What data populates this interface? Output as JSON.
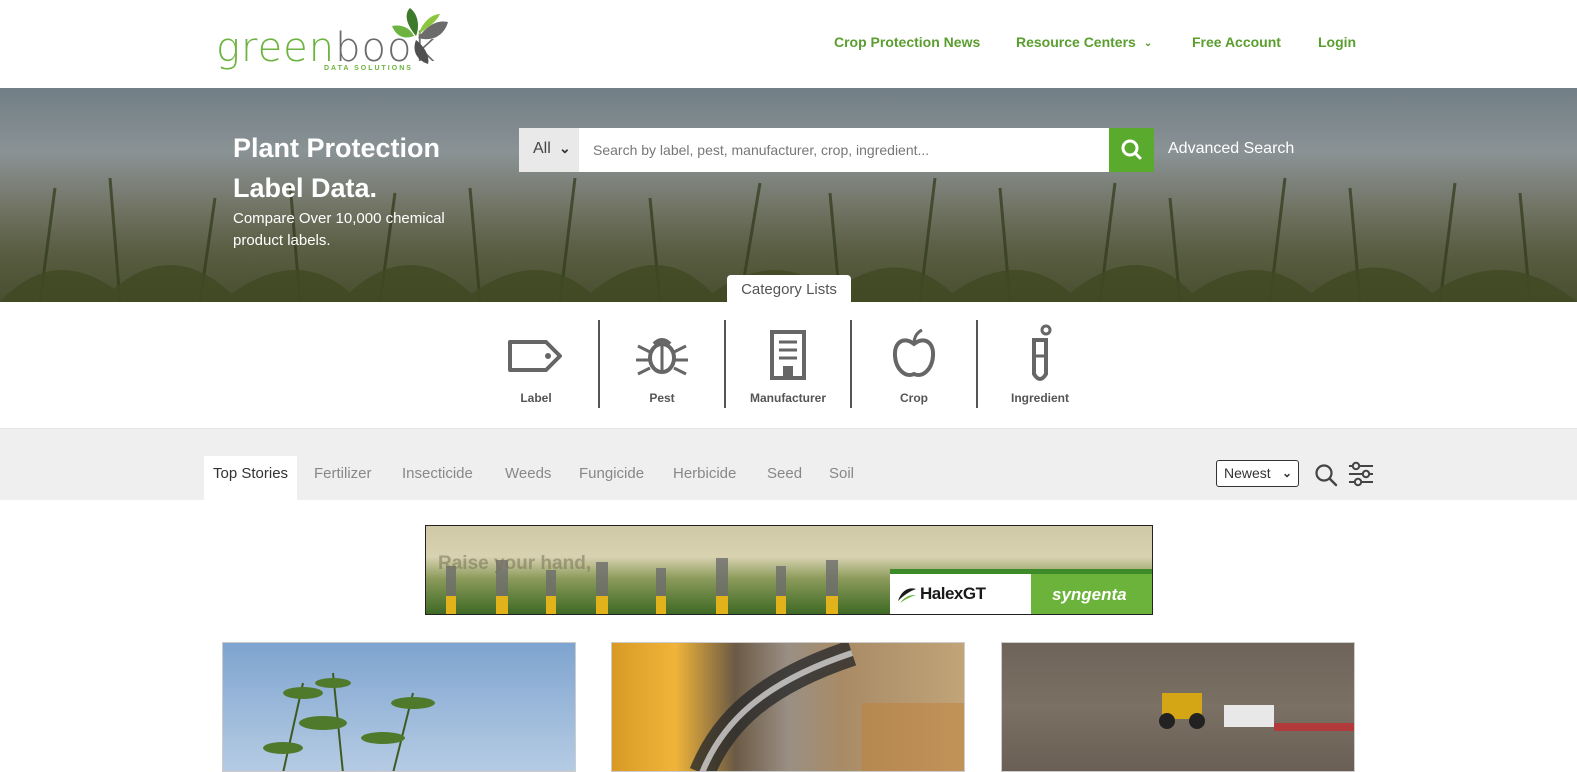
{
  "header": {
    "logo_word_a": "green",
    "logo_word_b": "book",
    "logo_sub": "DATA SOLUTIONS",
    "nav": {
      "news": "Crop Protection News",
      "resources": "Resource Centers",
      "free_account": "Free Account",
      "login": "Login"
    }
  },
  "hero": {
    "title": "Plant Protection Label Data.",
    "subtitle": "Compare Over 10,000 chemical product labels.",
    "search": {
      "scope": "All",
      "placeholder": "Search by label, pest, manufacturer, crop, ingredient...",
      "advanced": "Advanced Search"
    },
    "category_tab": "Category Lists"
  },
  "categories": [
    {
      "label": "Label",
      "icon": "tag-icon"
    },
    {
      "label": "Pest",
      "icon": "bug-icon"
    },
    {
      "label": "Manufacturer",
      "icon": "building-icon"
    },
    {
      "label": "Crop",
      "icon": "apple-icon"
    },
    {
      "label": "Ingredient",
      "icon": "test-tube-icon"
    }
  ],
  "stories": {
    "tabs": [
      "Top Stories",
      "Fertilizer",
      "Insecticide",
      "Weeds",
      "Fungicide",
      "Herbicide",
      "Seed",
      "Soil"
    ],
    "active_tab": 0,
    "sort": "Newest"
  },
  "ad": {
    "headline": "Raise your hand,",
    "brand1": "HalexGT",
    "brand2": "syngenta"
  },
  "colors": {
    "accent_green": "#5aaa2d",
    "nav_green": "#5a9e2f",
    "text_gray": "#555555"
  }
}
